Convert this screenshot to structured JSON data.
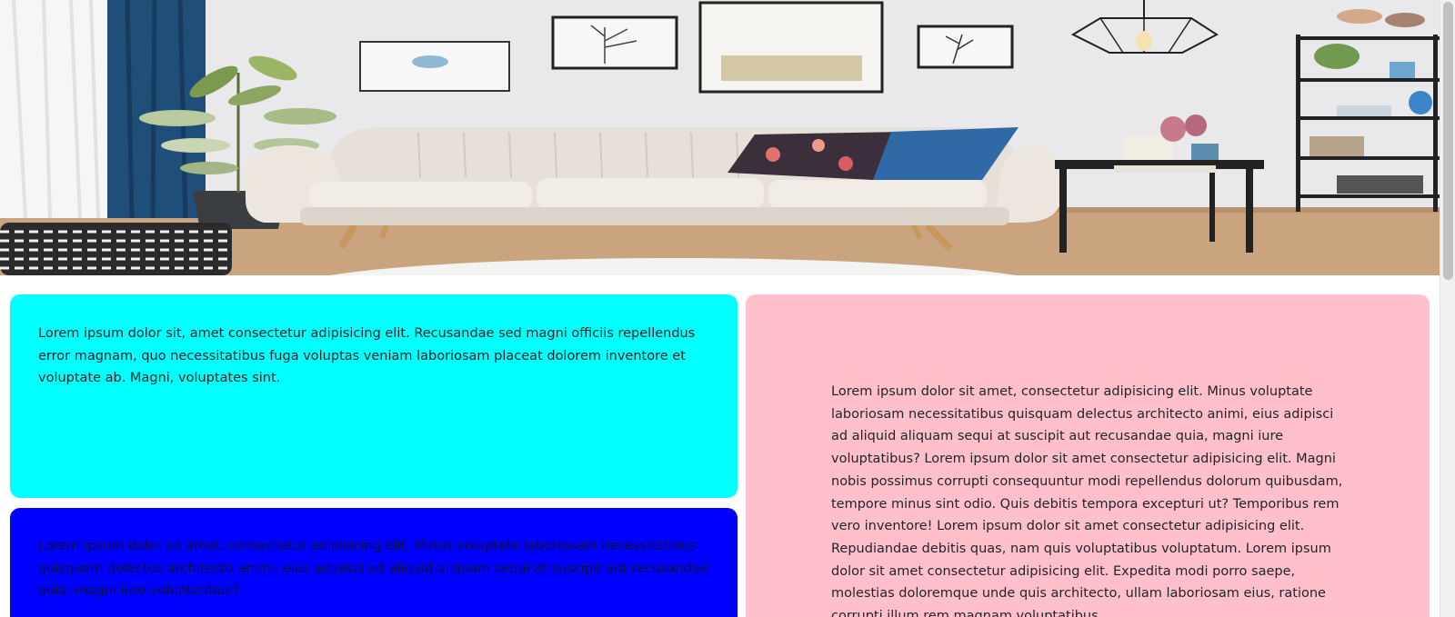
{
  "hero": {
    "image_alt": "Modern living room interior with a white sofa, plant, wall art and shelving"
  },
  "cards": {
    "cyan": {
      "text": "Lorem ipsum dolor sit, amet consectetur adipisicing elit. Recusandae sed magni officiis repellendus error magnam, quo necessitatibus fuga voluptas veniam laboriosam placeat dolorem inventore et voluptate ab. Magni, voluptates sint.",
      "color": "#00ffff"
    },
    "blue": {
      "text": "Lorem ipsum dolor sit amet, consectetur adipisicing elit. Minus voluptate laboriosam necessitatibus quisquam delectus architecto animi, eius adipisci ad aliquid aliquam sequi at suscipit aut recusandae quia, magni iure voluptatibus?",
      "color": "#0000ff"
    },
    "pink": {
      "text": "Lorem ipsum dolor sit amet, consectetur adipisicing elit. Minus voluptate laboriosam necessitatibus quisquam delectus architecto animi, eius adipisci ad aliquid aliquam sequi at suscipit aut recusandae quia, magni iure voluptatibus? Lorem ipsum dolor sit amet consectetur adipisicing elit. Magni nobis possimus corrupti consequuntur modi repellendus dolorum quibusdam, tempore minus sint odio. Quis debitis tempora excepturi ut? Temporibus rem vero inventore! Lorem ipsum dolor sit amet consectetur adipisicing elit. Repudiandae debitis quas, nam quis voluptatibus voluptatum. Lorem ipsum dolor sit amet consectetur adipisicing elit. Expedita modi porro saepe, molestias doloremque unde quis architecto, ullam laboriosam eius, ratione corrupti illum rem magnam voluptatibus.",
      "color": "#ffc0cb"
    }
  }
}
